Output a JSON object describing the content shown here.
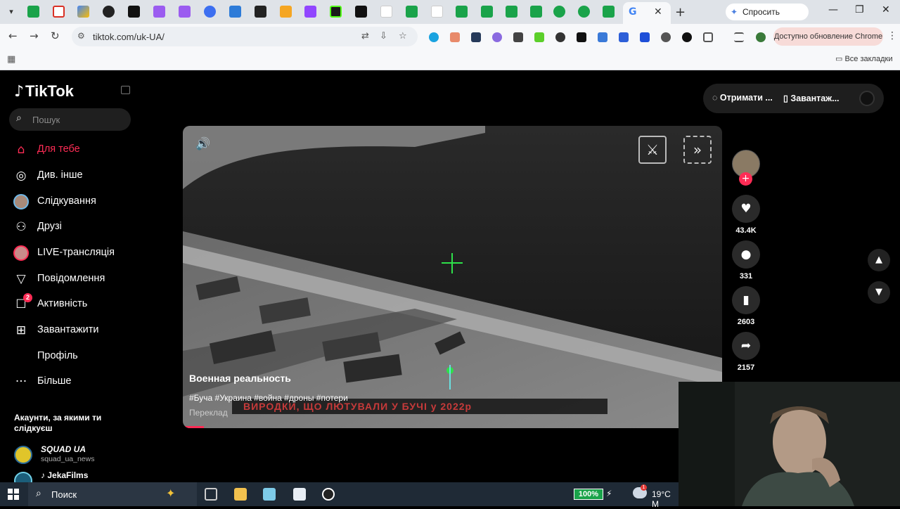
{
  "browser": {
    "active_tab_close": "✕",
    "new_tab": "+",
    "gemini_label": "Спросить Gemini",
    "url": "tiktok.com/uk-UA/",
    "update_label": "Доступно обновление Chrome",
    "all_bookmarks": "Все закладки",
    "window_controls": [
      "—",
      "❐",
      "✕"
    ]
  },
  "sidebar": {
    "logo": "TikTok",
    "search_placeholder": "Пошук",
    "items": [
      {
        "label": "Для тебе",
        "icon": "home-icon",
        "active": true
      },
      {
        "label": "Див. інше",
        "icon": "compass-icon"
      },
      {
        "label": "Слідкування",
        "icon": "avatar-icon"
      },
      {
        "label": "Друзі",
        "icon": "friends-icon"
      },
      {
        "label": "LIVE-трансляція",
        "icon": "live-avatar-icon"
      },
      {
        "label": "Повідомлення",
        "icon": "send-icon"
      },
      {
        "label": "Активність",
        "icon": "activity-icon",
        "badge": "2"
      },
      {
        "label": "Завантажити",
        "icon": "upload-icon"
      },
      {
        "label": "Профіль",
        "icon": "profile-avatar-icon"
      },
      {
        "label": "Більше",
        "icon": "more-icon"
      }
    ],
    "following_title": "Акаунти, за якими ти слідкуєш",
    "accounts": [
      {
        "name": "SQUAD UA",
        "handle": "squad_ua_news"
      },
      {
        "name": "JekaFilms",
        "handle": ""
      }
    ]
  },
  "topbar": {
    "get_coins": "Отримати ...",
    "download_app": "Завантаж..."
  },
  "video": {
    "title": "Военная реальность",
    "tags": "#Буча #Украина #война #дроны #потери",
    "translate": "Переклад",
    "subtitle": "ВИРОДКИ, ЩО ЛЮТУВАЛИ У БУЧІ у 2022р"
  },
  "actions": {
    "likes": "43.4K",
    "comments": "331",
    "saves": "2603",
    "shares": "2157"
  },
  "taskbar": {
    "search": "Поиск",
    "battery": "100%",
    "weather_badge": "1",
    "temp": "19°C  M"
  },
  "colors": {
    "accent": "#fe2c55",
    "crosshair": "#2ee04a"
  }
}
